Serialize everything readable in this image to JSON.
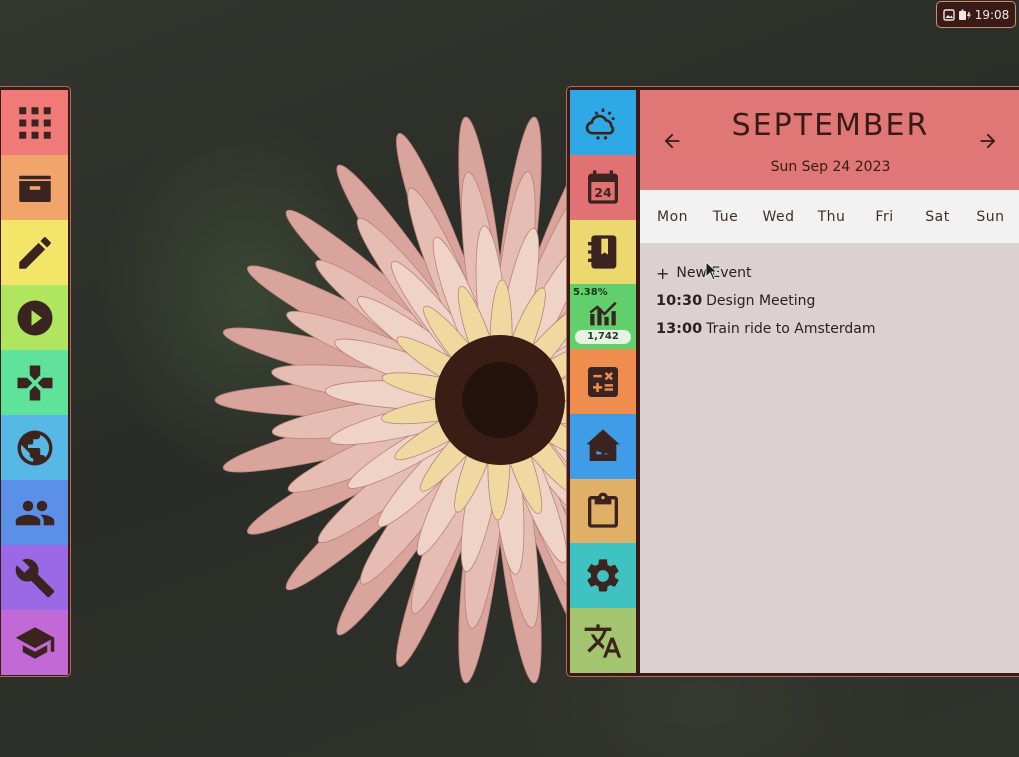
{
  "status_bar": {
    "time": "19:08",
    "icons": [
      "image-icon",
      "battery-charging-icon"
    ]
  },
  "left_dock": {
    "items": [
      {
        "name": "apps",
        "icon": "grid-icon",
        "color": "#f07a78"
      },
      {
        "name": "files",
        "icon": "folder-icon",
        "color": "#f1a56b"
      },
      {
        "name": "editor",
        "icon": "pencil-icon",
        "color": "#f3e568"
      },
      {
        "name": "media",
        "icon": "play-icon",
        "color": "#b0e55f"
      },
      {
        "name": "games",
        "icon": "gamepad-icon",
        "color": "#5fe39b"
      },
      {
        "name": "browser",
        "icon": "globe-icon",
        "color": "#57b8e6"
      },
      {
        "name": "contacts",
        "icon": "people-icon",
        "color": "#5b8fe8"
      },
      {
        "name": "tools",
        "icon": "wrench-icon",
        "color": "#9b69e6"
      },
      {
        "name": "education",
        "icon": "graduation-cap-icon",
        "color": "#c16ad6"
      }
    ]
  },
  "right_dock": {
    "items": [
      {
        "name": "weather",
        "icon": "weather-icon",
        "color": "#2fa8e6"
      },
      {
        "name": "calendar",
        "icon": "calendar-icon",
        "color": "#e27174",
        "day": "24"
      },
      {
        "name": "notes",
        "icon": "notebook-icon",
        "color": "#ecd86e"
      },
      {
        "name": "stocks",
        "icon": "stocks-icon",
        "color": "#61cf6b",
        "percent": "5.38%",
        "count": "1,742"
      },
      {
        "name": "calculator",
        "icon": "calculator-icon",
        "color": "#ef8d4e"
      },
      {
        "name": "home-assistant",
        "icon": "home-assistant-icon",
        "color": "#3f9ce6"
      },
      {
        "name": "clipboard",
        "icon": "clipboard-icon",
        "color": "#dfb066"
      },
      {
        "name": "settings",
        "icon": "gear-icon",
        "color": "#3ec3c2"
      },
      {
        "name": "translate",
        "icon": "translate-icon",
        "color": "#a3c56f"
      }
    ]
  },
  "calendar": {
    "month": "SEPTEMBER",
    "date": "Sun Sep 24 2023",
    "weekdays": [
      "Mon",
      "Tue",
      "Wed",
      "Thu",
      "Fri",
      "Sat",
      "Sun"
    ],
    "new_event_label": "New Event",
    "events": [
      {
        "time": "10:30",
        "title": "Design Meeting"
      },
      {
        "time": "13:00",
        "title": "Train ride to Amsterdam"
      }
    ]
  },
  "colors": {
    "accent": "#de7776",
    "panel_border": "#b46f52",
    "panel_dark": "#3a1a17"
  }
}
